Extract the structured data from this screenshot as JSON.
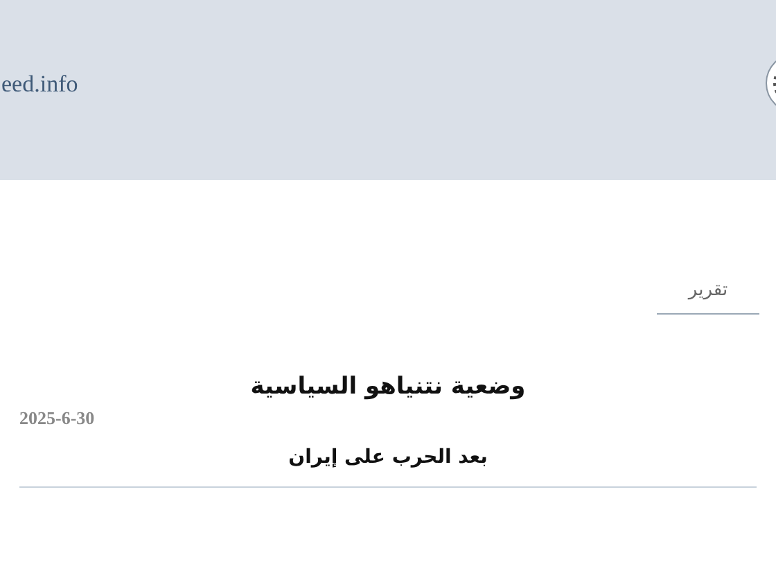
{
  "header": {
    "site_name": "eed.info"
  },
  "category": "تقرير",
  "article": {
    "title": "وضعية نتنياهو السياسية",
    "date": "2025-6-30",
    "subtitle": "بعد الحرب على إيران"
  }
}
